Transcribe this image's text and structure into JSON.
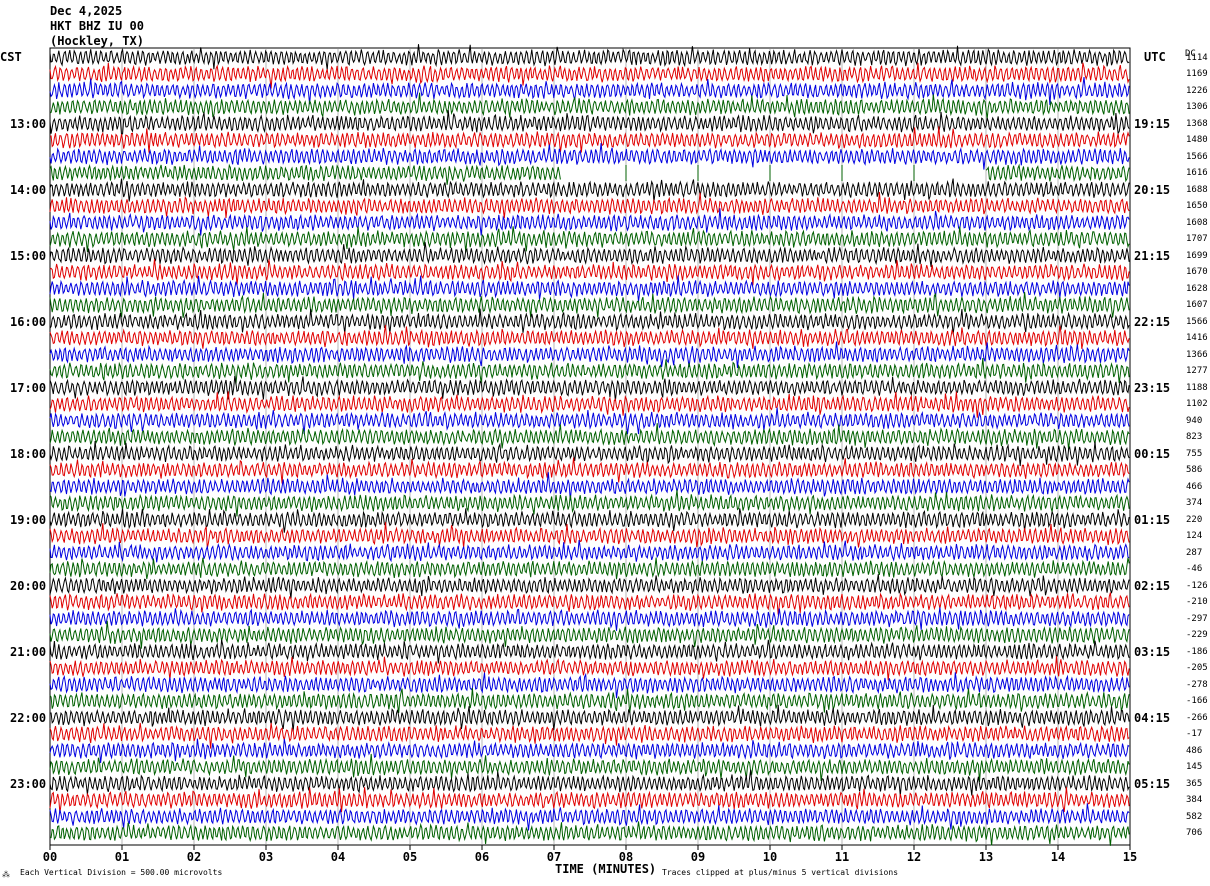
{
  "header": {
    "date": "Dec 4,2025",
    "station": "HKT BHZ IU 00",
    "location": "(Hockley, TX)"
  },
  "left_tz": "CST",
  "right_tz": "UTC",
  "dc_header": "DC",
  "footer": {
    "scale_note": "Each Vertical Division =  500.00 microvolts",
    "clip_note": "Traces clipped at plus/minus 5 vertical divisions",
    "corner_mark": "⁂"
  },
  "chart_data": {
    "type": "line",
    "title": "",
    "xlabel": "TIME (MINUTES)",
    "ylabel": "",
    "xlim": [
      0,
      15
    ],
    "x_ticks": [
      "00",
      "01",
      "02",
      "03",
      "04",
      "05",
      "06",
      "07",
      "08",
      "09",
      "10",
      "11",
      "12",
      "13",
      "14",
      "15"
    ],
    "left_hour_labels": [
      "13:00",
      "14:00",
      "15:00",
      "16:00",
      "17:00",
      "18:00",
      "19:00",
      "20:00",
      "21:00",
      "22:00",
      "23:00"
    ],
    "right_hour_labels": [
      "19:15",
      "20:15",
      "21:15",
      "22:15",
      "23:15",
      "00:15",
      "01:15",
      "02:15",
      "03:15",
      "04:15",
      "05:15"
    ],
    "trace_colors": [
      "#000000",
      "#e00000",
      "#0000e0",
      "#006000"
    ],
    "trace_count": 48,
    "dc_offsets": [
      "1114",
      "1169",
      "1226",
      "1306",
      "1368",
      "1480",
      "1566",
      "1616",
      "1688",
      "1650",
      "1608",
      "1707",
      "1699",
      "1670",
      "1628",
      "1607",
      "1566",
      "1416",
      "1366",
      "1277",
      "1188",
      "1102",
      "940",
      "823",
      "755",
      "586",
      "466",
      "374",
      "220",
      "124",
      "287",
      "-46",
      "-126",
      "-210",
      "-297",
      "-229",
      "-186",
      "-205",
      "-278",
      "-166",
      "-266",
      "-17",
      "486",
      "145",
      "365",
      "384",
      "582",
      "706"
    ],
    "gap": {
      "row": 7,
      "from_minute": 7.1,
      "to_minute": 13.0,
      "marker_minutes": [
        8.0,
        9.0,
        10.0,
        11.0,
        12.0
      ]
    },
    "grid": "vertical-minute-lines"
  }
}
